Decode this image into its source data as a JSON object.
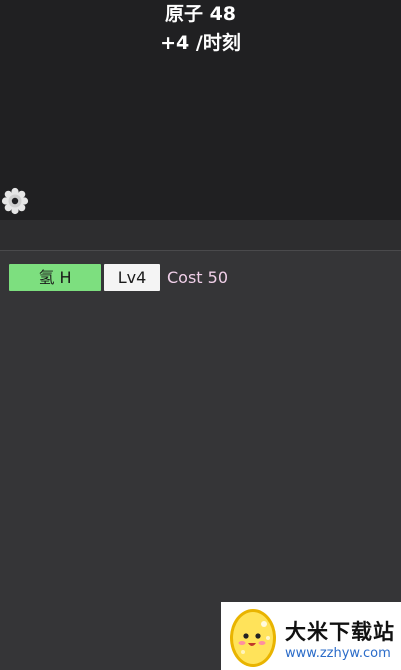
{
  "header": {
    "atoms_text": "原子 48",
    "rate_text": "+4 /时刻"
  },
  "settings": {
    "icon": "gear-icon"
  },
  "upgrade_row": {
    "element_label": "氢 H",
    "level_label": "Lv4",
    "cost_text": "Cost 50",
    "element_color": "#7ddf7f"
  },
  "watermark": {
    "title": "大米下载站",
    "url": "www.zzhyw.com"
  },
  "colors": {
    "top_background": "#202022",
    "main_background": "#353537",
    "cost_text": "#f0cfe8"
  }
}
